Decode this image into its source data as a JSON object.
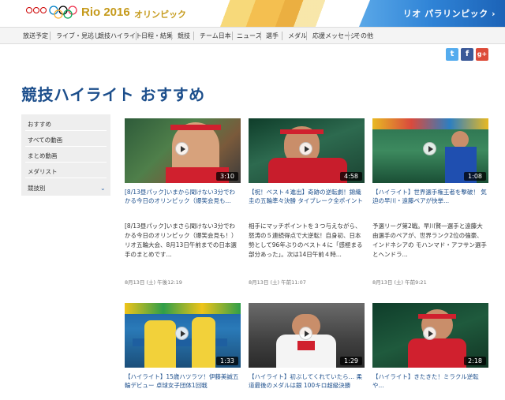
{
  "header": {
    "title": "Rio 2016",
    "subtitle": "オリンピック",
    "logo_small": "NHK Rio 2016",
    "paralympic_link": "リオ パラリンピック ›"
  },
  "nav": {
    "items": [
      "放送予定",
      "ライブ・見逃し",
      "競技ハイライト",
      "日程・結果",
      "競技",
      "チーム日本",
      "ニュース",
      "選手",
      "メダル",
      "応援メッセージ",
      "その他"
    ]
  },
  "social": {
    "twitter": "t",
    "facebook": "f",
    "gplus": "g+"
  },
  "page": {
    "title": "競技ハイライト おすすめ"
  },
  "sidebar": {
    "items": [
      "おすすめ",
      "すべての動画",
      "まとめ動画",
      "メダリスト",
      "競技別"
    ]
  },
  "cards": [
    {
      "duration": "3:10",
      "title": "[8/13昼パック]いまから聞けない3分でわかる今日のオリンピック（爆笑会見も...",
      "desc": "[8/13昼パック]いまさら聞けない3分でわかる今日のオリンピック（爆笑会見も！）　リオ五輪大会、8月13日午前までの日本選手のまとめです...",
      "date": "8月13日 (土) 午後12:19"
    },
    {
      "duration": "4:58",
      "title": "【祝！ベスト４進出】奇跡の逆転劇！錦織圭の五輪準々決勝 タイブレーク全ポイント",
      "desc": "相手にマッチポイントを３つ与えながら、怒涛の５連続得点で大逆転！自身初、日本勢として96年ぶりのベスト４に「感極まる部分あった」。次は14日午前４時...",
      "date": "8月13日 (土) 午前11:07"
    },
    {
      "duration": "1:08",
      "title": "【ハイライト】世界選手権王者を撃破！ 気迫の早川・遠藤ペアが快挙...",
      "desc": "予選リーグ第2戦。早川賢一選手と遠藤大由選手のペアが、世界ランク2位の強豪、インドネシアの モハンマド・アフサン選手とヘンドラ...",
      "date": "8月13日 (土) 午前9:21"
    },
    {
      "duration": "1:33",
      "title": "【ハイライト】15歳ハツラツ！伊藤美誠五輪デビュー 卓球女子団体1回戦",
      "desc": "",
      "date": ""
    },
    {
      "duration": "1:29",
      "title": "【ハイライト】初ぶしてくれていたら… 柔道最後のメダルは銀 100キロ超級決勝",
      "desc": "",
      "date": ""
    },
    {
      "duration": "2:18",
      "title": "【ハイライト】きたきた！ミラクル逆転や...",
      "desc": "",
      "date": ""
    }
  ],
  "colors": {
    "accent_blue": "#1d4f8c",
    "gold": "#c59a1b",
    "twitter": "#55acee",
    "facebook": "#3b5998",
    "gplus": "#dd4b39"
  }
}
